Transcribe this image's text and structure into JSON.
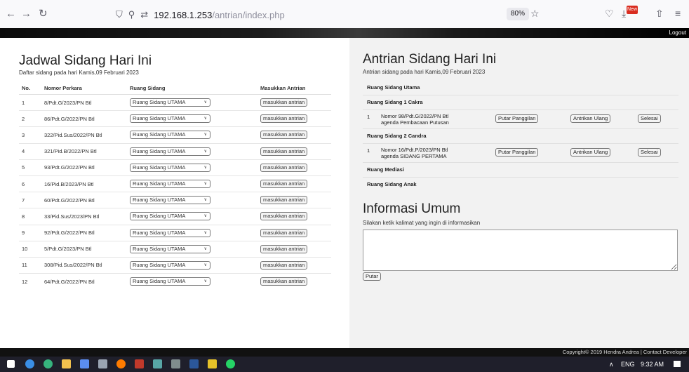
{
  "browser": {
    "url_host": "192.168.1.253",
    "url_path": "/antrian/index.php",
    "zoom": "80%",
    "new_badge": "New",
    "icons": [
      "back-arrow-icon",
      "forward-arrow-icon",
      "reload-icon",
      "shield-icon",
      "lock-icon",
      "permissions-icon",
      "star-icon",
      "pocket-icon",
      "download-icon",
      "extension-icon",
      "share-icon",
      "menu-icon"
    ]
  },
  "header": {
    "logout": "Logout"
  },
  "left": {
    "title": "Jadwal Sidang Hari Ini",
    "subtitle": "Daftar sidang pada hari Kamis,09 Februari 2023",
    "columns": [
      "No.",
      "Nomor Perkara",
      "Ruang Sidang",
      "Masukkan Antrian"
    ],
    "select_value": "Ruang Sidang UTAMA",
    "button_label": "masukkan antrian",
    "rows": [
      {
        "no": "1",
        "perkara": "8/Pdt.G/2023/PN Btl"
      },
      {
        "no": "2",
        "perkara": "86/Pdt.G/2022/PN Btl"
      },
      {
        "no": "3",
        "perkara": "322/Pid.Sus/2022/PN Btl"
      },
      {
        "no": "4",
        "perkara": "321/Pid.B/2022/PN Btl"
      },
      {
        "no": "5",
        "perkara": "93/Pdt.G/2022/PN Btl"
      },
      {
        "no": "6",
        "perkara": "16/Pid.B/2023/PN Btl"
      },
      {
        "no": "7",
        "perkara": "60/Pdt.G/2022/PN Btl"
      },
      {
        "no": "8",
        "perkara": "33/Pid.Sus/2023/PN Btl"
      },
      {
        "no": "9",
        "perkara": "92/Pdt.G/2022/PN Btl"
      },
      {
        "no": "10",
        "perkara": "5/Pdt.G/2023/PN Btl"
      },
      {
        "no": "11",
        "perkara": "308/Pid.Sus/2022/PN Btl"
      },
      {
        "no": "12",
        "perkara": "64/Pdt.G/2022/PN Btl"
      }
    ]
  },
  "right": {
    "title": "Antrian Sidang Hari Ini",
    "subtitle": "Antrian sidang pada hari Kamis,09 Februari 2023",
    "rooms": {
      "utama": "Ruang Sidang Utama",
      "cakra": "Ruang Sidang 1 Cakra",
      "candra": "Ruang Sidang 2 Candra",
      "mediasi": "Ruang Mediasi",
      "anak": "Ruang Sidang Anak"
    },
    "queue": [
      {
        "no": "1",
        "line1": "Nomor 98/Pdt.G/2022/PN Btl",
        "line2": "agenda Pembacaan Putusan"
      },
      {
        "no": "1",
        "line1": "Nomor 16/Pdt.P/2023/PN Btl",
        "line2": "agenda SIDANG PERTAMA"
      }
    ],
    "buttons": {
      "call": "Putar Panggilan",
      "repeat": "Antrikan Ulang",
      "done": "Selesai"
    },
    "info_title": "Informasi Umum",
    "info_subtitle": "Silakan ketik kalimat yang ingin di informasikan",
    "play_button": "Putar"
  },
  "footer": {
    "copyright": "Copyright© 2019 Hendra Andrea | Contact Developer"
  },
  "taskbar": {
    "lang": "ENG",
    "time": "9:32 AM"
  }
}
